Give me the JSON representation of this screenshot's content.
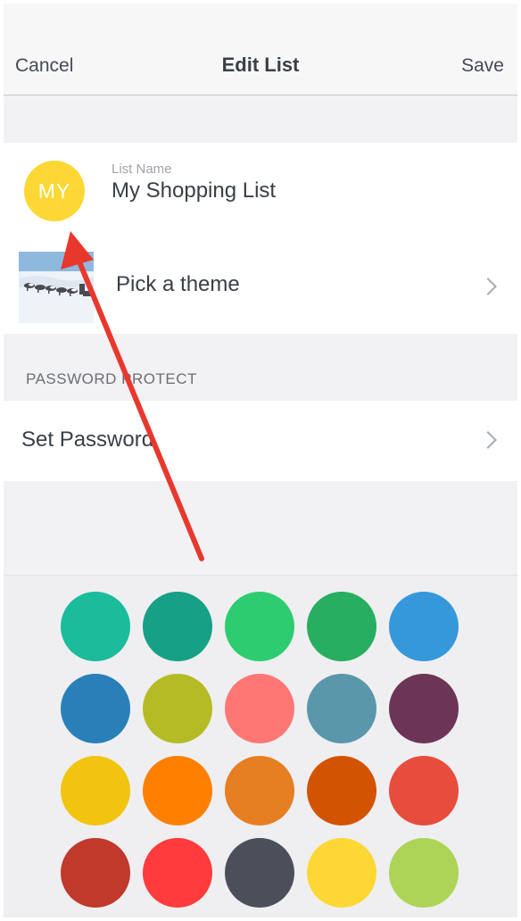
{
  "nav": {
    "cancel_label": "Cancel",
    "title": "Edit List",
    "save_label": "Save"
  },
  "list_name": {
    "avatar_initials": "MY",
    "avatar_color": "#fdd835",
    "label": "List Name",
    "value": "My Shopping List"
  },
  "theme": {
    "label": "Pick a theme",
    "thumbnail": "sled-dogs-snow-photo",
    "chevron_icon": "chevron-right-icon"
  },
  "password": {
    "section_header": "PASSWORD PROTECT",
    "label": "Set Password",
    "chevron_icon": "chevron-right-icon"
  },
  "palette": {
    "rows": [
      [
        "#1abc9c",
        "#16a085",
        "#2ecc71",
        "#27ae60",
        "#3498db"
      ],
      [
        "#2980b9",
        "#b5bb25",
        "#ff7675",
        "#5b97ab",
        "#6c3455"
      ],
      [
        "#f1c40f",
        "#ff7f00",
        "#e67e22",
        "#d35400",
        "#e74c3c"
      ],
      [
        "#c0392b",
        "#ff3b3b",
        "#4a4f5a",
        "#fdd835",
        "#add456"
      ]
    ]
  },
  "annotation": {
    "arrow_color": "#e8382e",
    "arrow_icon": "red-arrow-annotation"
  }
}
